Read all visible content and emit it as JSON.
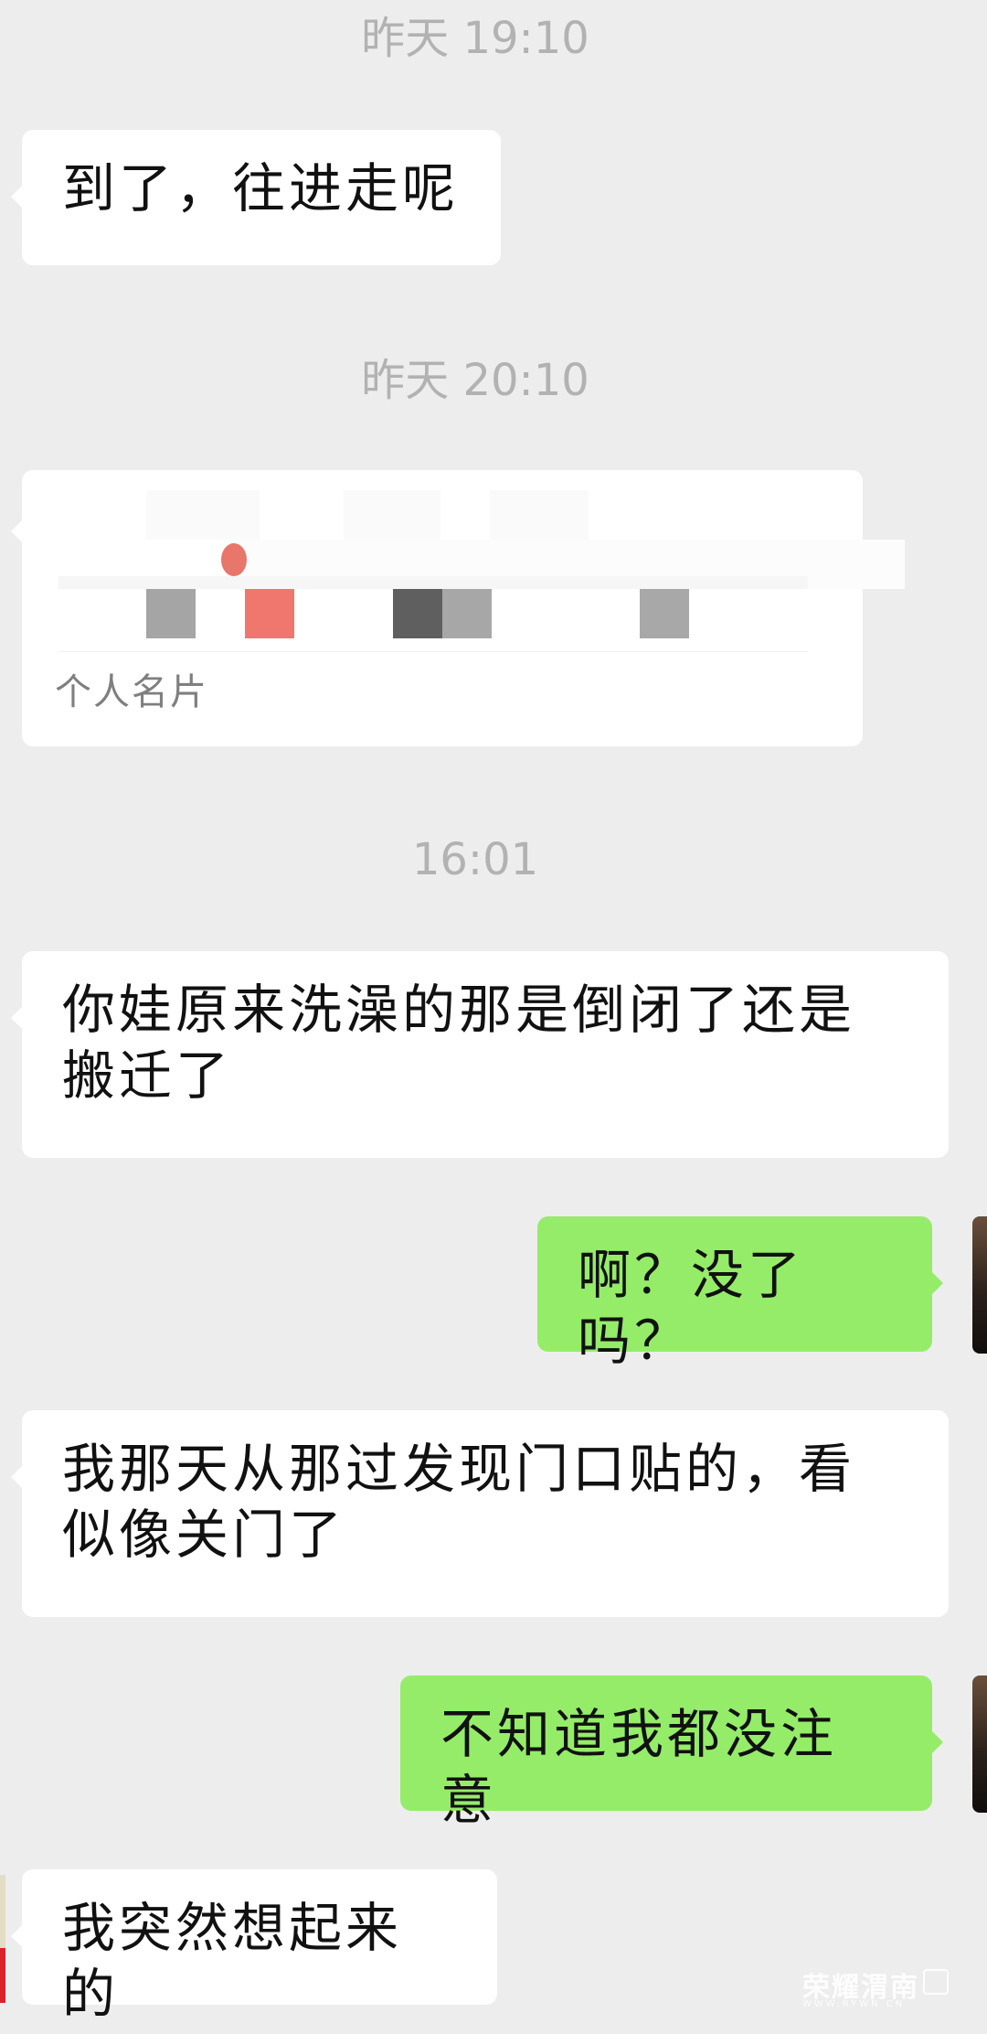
{
  "timestamps": {
    "t1": "昨天 19:10",
    "t2": "昨天 20:10",
    "t3": "16:01"
  },
  "messages": [
    {
      "from": "other",
      "text": "到了，往进走呢"
    },
    {
      "from": "other",
      "text": "你娃原来洗澡的那是倒闭了还是搬迁了"
    },
    {
      "from": "self",
      "text": "啊？没了吗？"
    },
    {
      "from": "other",
      "text": "我那天从那过发现门口贴的，看似像关门了"
    },
    {
      "from": "self",
      "text": "不知道我都没注意"
    },
    {
      "from": "other",
      "text": "我突然想起来的"
    }
  ],
  "contact_card": {
    "label": "个人名片",
    "name_redacted": true
  },
  "watermark": {
    "brand": "荣耀渭南",
    "site": "WWW.RYWN.CN"
  },
  "colors": {
    "background": "#ededed",
    "incoming_bubble": "#ffffff",
    "outgoing_bubble": "#95ec69",
    "timestamp_text": "#b2b2b2"
  }
}
